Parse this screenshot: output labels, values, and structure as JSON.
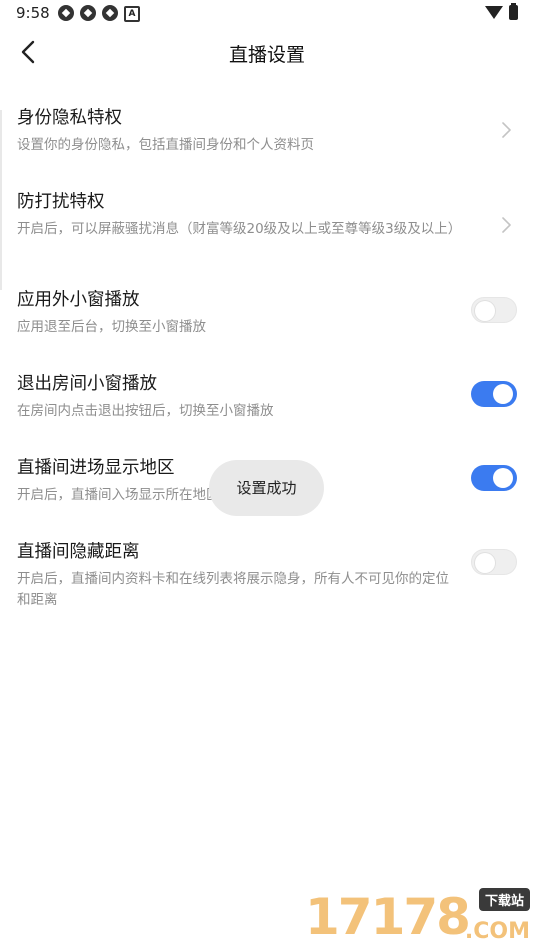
{
  "status_bar": {
    "time": "9:58",
    "left_icons": [
      "app-notification-icon",
      "app-notification-icon",
      "app-notification-icon",
      "a-badge-icon"
    ],
    "a_badge": "A",
    "right_icons": [
      "wifi-icon",
      "battery-icon"
    ]
  },
  "header": {
    "title": "直播设置",
    "back_icon": "chevron-left-icon"
  },
  "settings": [
    {
      "title": "身份隐私特权",
      "desc": "设置你的身份隐私，包括直播间身份和个人资料页",
      "control": "chevron"
    },
    {
      "title": "防打扰特权",
      "desc": "开启后，可以屏蔽骚扰消息（财富等级20级及以上或至尊等级3级及以上）",
      "control": "chevron"
    },
    {
      "title": "应用外小窗播放",
      "desc": "应用退至后台，切换至小窗播放",
      "control": "toggle",
      "enabled": false
    },
    {
      "title": "退出房间小窗播放",
      "desc": "在房间内点击退出按钮后，切换至小窗播放",
      "control": "toggle",
      "enabled": true
    },
    {
      "title": "直播间进场显示地区",
      "desc": "开启后，直播间入场显示所在地区",
      "control": "toggle",
      "enabled": true
    },
    {
      "title": "直播间隐藏距离",
      "desc": "开启后，直播间内资料卡和在线列表将展示隐身，所有人不可见你的定位和距离",
      "control": "toggle",
      "enabled": false
    }
  ],
  "toast": "设置成功",
  "watermark": {
    "digits": "17178",
    "tag": "下载站",
    "suffix": ".COM"
  },
  "colors": {
    "toggle_on": "#3b7bf0",
    "toggle_off": "#efefef",
    "desc_text": "#8e8e8e"
  }
}
